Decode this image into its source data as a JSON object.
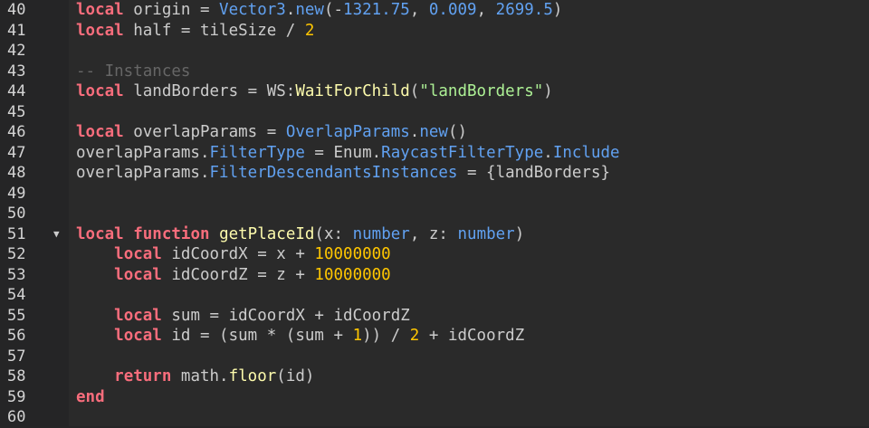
{
  "lines": [
    {
      "num": "40",
      "fold": "",
      "tokens": [
        {
          "t": "local",
          "c": "kw"
        },
        {
          "t": " origin = ",
          "c": "id"
        },
        {
          "t": "Vector3",
          "c": "prop"
        },
        {
          "t": ".",
          "c": "id"
        },
        {
          "t": "new",
          "c": "prop"
        },
        {
          "t": "(-",
          "c": "id"
        },
        {
          "t": "1321.75",
          "c": "prop"
        },
        {
          "t": ", ",
          "c": "id"
        },
        {
          "t": "0.009",
          "c": "prop"
        },
        {
          "t": ", ",
          "c": "id"
        },
        {
          "t": "2699.5",
          "c": "prop"
        },
        {
          "t": ")",
          "c": "id"
        }
      ]
    },
    {
      "num": "41",
      "fold": "",
      "tokens": [
        {
          "t": "local",
          "c": "kw"
        },
        {
          "t": " half = tileSize / ",
          "c": "id"
        },
        {
          "t": "2",
          "c": "num"
        }
      ]
    },
    {
      "num": "42",
      "fold": "",
      "tokens": []
    },
    {
      "num": "43",
      "fold": "",
      "tokens": [
        {
          "t": "-- Instances",
          "c": "cm"
        }
      ]
    },
    {
      "num": "44",
      "fold": "",
      "tokens": [
        {
          "t": "local",
          "c": "kw"
        },
        {
          "t": " landBorders = WS:",
          "c": "id"
        },
        {
          "t": "WaitForChild",
          "c": "method"
        },
        {
          "t": "(",
          "c": "id"
        },
        {
          "t": "\"landBorders\"",
          "c": "str"
        },
        {
          "t": ")",
          "c": "id"
        }
      ]
    },
    {
      "num": "45",
      "fold": "",
      "tokens": []
    },
    {
      "num": "46",
      "fold": "",
      "tokens": [
        {
          "t": "local",
          "c": "kw"
        },
        {
          "t": " overlapParams = ",
          "c": "id"
        },
        {
          "t": "OverlapParams",
          "c": "prop"
        },
        {
          "t": ".",
          "c": "id"
        },
        {
          "t": "new",
          "c": "prop"
        },
        {
          "t": "()",
          "c": "id"
        }
      ]
    },
    {
      "num": "47",
      "fold": "",
      "tokens": [
        {
          "t": "overlapParams.",
          "c": "id"
        },
        {
          "t": "FilterType",
          "c": "prop"
        },
        {
          "t": " = Enum.",
          "c": "id"
        },
        {
          "t": "RaycastFilterType",
          "c": "prop"
        },
        {
          "t": ".",
          "c": "id"
        },
        {
          "t": "Include",
          "c": "prop"
        }
      ]
    },
    {
      "num": "48",
      "fold": "",
      "tokens": [
        {
          "t": "overlapParams.",
          "c": "id"
        },
        {
          "t": "FilterDescendantsInstances",
          "c": "prop"
        },
        {
          "t": " = {landBorders}",
          "c": "id"
        }
      ]
    },
    {
      "num": "49",
      "fold": "",
      "tokens": []
    },
    {
      "num": "50",
      "fold": "",
      "tokens": []
    },
    {
      "num": "51",
      "fold": "▼",
      "tokens": [
        {
          "t": "local",
          "c": "kw"
        },
        {
          "t": " ",
          "c": "id"
        },
        {
          "t": "function",
          "c": "kw"
        },
        {
          "t": " ",
          "c": "id"
        },
        {
          "t": "getPlaceId",
          "c": "fn"
        },
        {
          "t": "(x: ",
          "c": "id"
        },
        {
          "t": "number",
          "c": "prop"
        },
        {
          "t": ", z: ",
          "c": "id"
        },
        {
          "t": "number",
          "c": "prop"
        },
        {
          "t": ")",
          "c": "id"
        }
      ]
    },
    {
      "num": "52",
      "fold": "",
      "tokens": [
        {
          "t": "    ",
          "c": "id"
        },
        {
          "t": "local",
          "c": "kw"
        },
        {
          "t": " idCoordX = x + ",
          "c": "id"
        },
        {
          "t": "10000000",
          "c": "num"
        }
      ]
    },
    {
      "num": "53",
      "fold": "",
      "tokens": [
        {
          "t": "    ",
          "c": "id"
        },
        {
          "t": "local",
          "c": "kw"
        },
        {
          "t": " idCoordZ = z + ",
          "c": "id"
        },
        {
          "t": "10000000",
          "c": "num"
        }
      ]
    },
    {
      "num": "54",
      "fold": "",
      "tokens": []
    },
    {
      "num": "55",
      "fold": "",
      "tokens": [
        {
          "t": "    ",
          "c": "id"
        },
        {
          "t": "local",
          "c": "kw"
        },
        {
          "t": " sum = idCoordX + idCoordZ",
          "c": "id"
        }
      ]
    },
    {
      "num": "56",
      "fold": "",
      "tokens": [
        {
          "t": "    ",
          "c": "id"
        },
        {
          "t": "local",
          "c": "kw"
        },
        {
          "t": " id = (sum * (sum + ",
          "c": "id"
        },
        {
          "t": "1",
          "c": "num"
        },
        {
          "t": ")) / ",
          "c": "id"
        },
        {
          "t": "2",
          "c": "num"
        },
        {
          "t": " + idCoordZ",
          "c": "id"
        }
      ]
    },
    {
      "num": "57",
      "fold": "",
      "tokens": []
    },
    {
      "num": "58",
      "fold": "",
      "tokens": [
        {
          "t": "    ",
          "c": "id"
        },
        {
          "t": "return",
          "c": "kw"
        },
        {
          "t": " math.",
          "c": "id"
        },
        {
          "t": "floor",
          "c": "method"
        },
        {
          "t": "(id)",
          "c": "id"
        }
      ]
    },
    {
      "num": "59",
      "fold": "",
      "tokens": [
        {
          "t": "end",
          "c": "kw"
        }
      ]
    },
    {
      "num": "60",
      "fold": "",
      "tokens": []
    }
  ]
}
